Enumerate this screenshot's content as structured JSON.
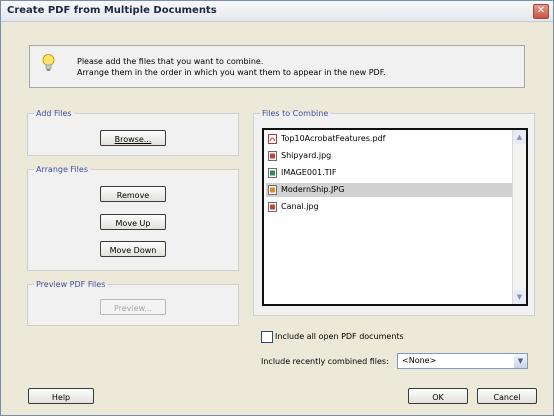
{
  "window": {
    "title": "Create PDF from Multiple Documents",
    "close_glyph": "✕"
  },
  "info": {
    "icon": "lightbulb-icon",
    "line1": "Please add the files that you want to combine.",
    "line2": "Arrange them in the order in which you want them to appear in the new PDF."
  },
  "add_files": {
    "legend": "Add Files",
    "browse": "Browse..."
  },
  "arrange_files": {
    "legend": "Arrange Files",
    "remove": "Remove",
    "move_up": "Move Up",
    "move_down": "Move Down"
  },
  "preview": {
    "legend": "Preview PDF Files",
    "preview_button": "Preview..."
  },
  "files": {
    "legend": "Files to Combine",
    "items": [
      {
        "name": "Top10AcrobatFeatures.pdf",
        "icon": "pdf-icon"
      },
      {
        "name": "Shipyard.jpg",
        "icon": "image-icon"
      },
      {
        "name": "IMAGE001.TIF",
        "icon": "image-icon"
      },
      {
        "name": "ModernShip.JPG",
        "icon": "image-icon",
        "selected": true
      },
      {
        "name": "Canal.jpg",
        "icon": "image-icon"
      }
    ]
  },
  "options": {
    "include_open_label": "Include all open PDF documents",
    "recent_label": "Include recently combined files:",
    "recent_value": "<None>"
  },
  "footer": {
    "help": "Help",
    "ok": "OK",
    "cancel": "Cancel"
  }
}
